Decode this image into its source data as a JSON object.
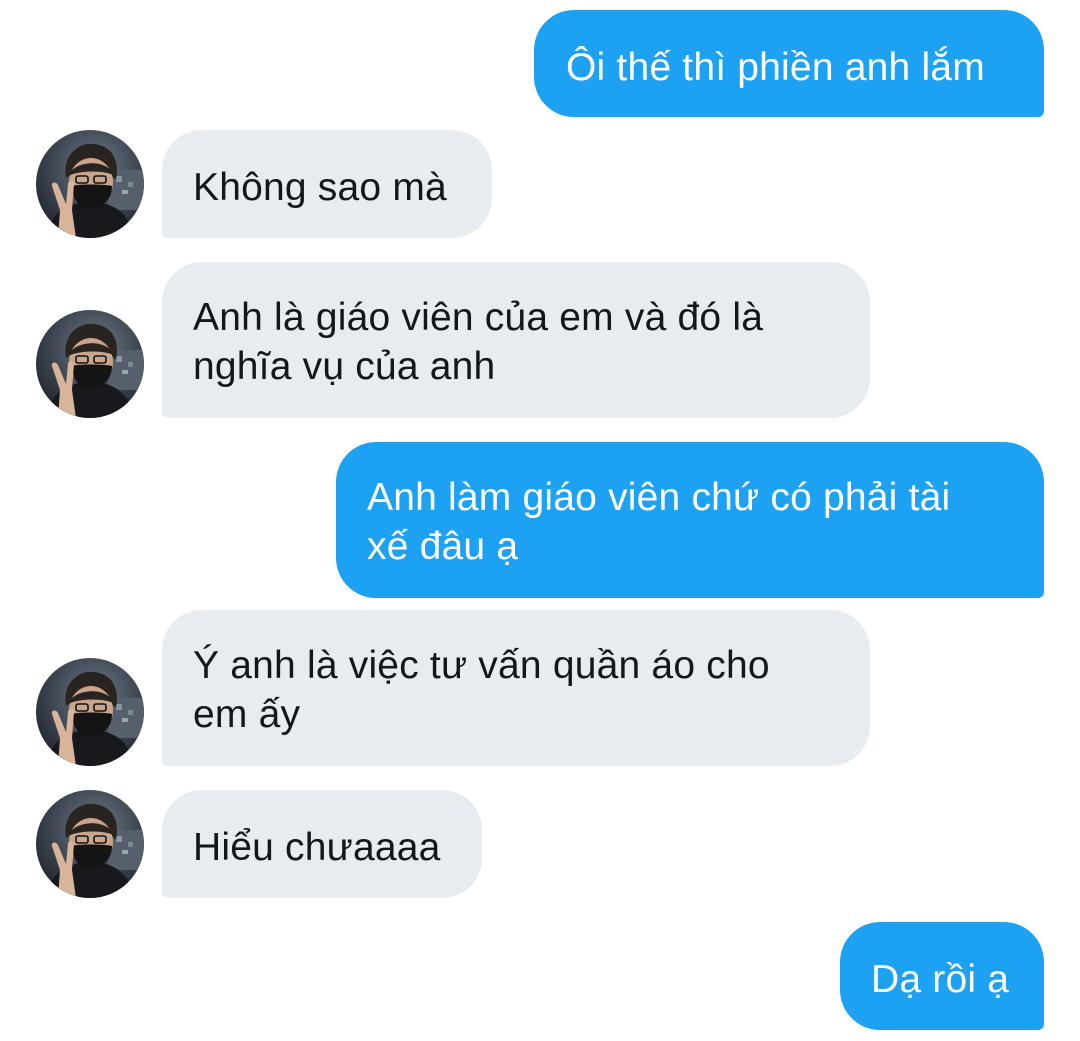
{
  "colors": {
    "sent_bubble": "#1da1f2",
    "received_bubble": "#e6ecf0",
    "sent_text": "#ffffff",
    "received_text": "#14171a"
  },
  "avatar_icon": "profile-photo-avatar",
  "messages": [
    {
      "direction": "sent",
      "text": "Ôi thế thì phiền anh lắm"
    },
    {
      "direction": "received",
      "text": "Không sao mà"
    },
    {
      "direction": "received",
      "text": "Anh là giáo viên của em và đó là nghĩa vụ của anh"
    },
    {
      "direction": "sent",
      "text": "Anh làm giáo viên chứ có phải tài xế đâu ạ"
    },
    {
      "direction": "received",
      "text": "Ý anh là việc tư vấn quần áo cho em ấy"
    },
    {
      "direction": "received",
      "text": "Hiểu chưaaaa"
    },
    {
      "direction": "sent",
      "text": "Dạ rồi ạ"
    }
  ]
}
